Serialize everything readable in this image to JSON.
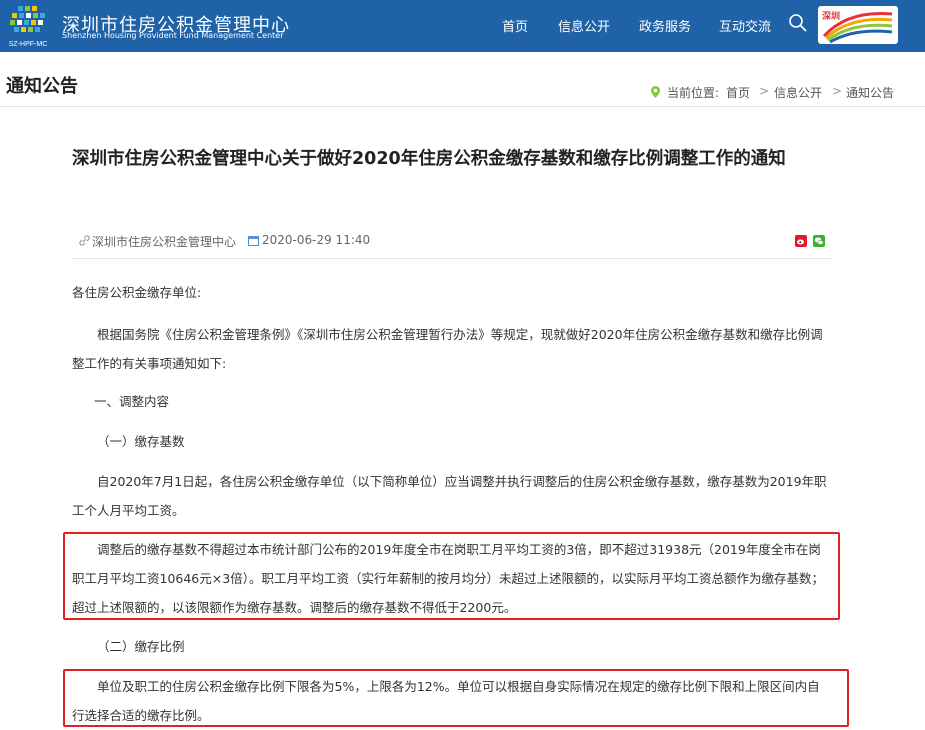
{
  "header": {
    "site_name_cn": "深圳市住房公积金管理中心",
    "site_name_en": "Shenzhen Housing Provident Fund Management Center",
    "logo_caption": "SZ-HPF-MC",
    "nav": [
      {
        "label": "首页"
      },
      {
        "label": "信息公开"
      },
      {
        "label": "政务服务"
      },
      {
        "label": "互动交流"
      }
    ],
    "brand_badge": "深圳"
  },
  "page": {
    "title": "通知公告",
    "breadcrumb": {
      "label": "当前位置:",
      "items": [
        "首页",
        "信息公开",
        "通知公告"
      ],
      "separator": ">"
    }
  },
  "article": {
    "title": "深圳市住房公积金管理中心关于做好2020年住房公积金缴存基数和缴存比例调整工作的通知",
    "source": "深圳市住房公积金管理中心",
    "date": "2020-06-29 11:40",
    "paragraphs": [
      "各住房公积金缴存单位:",
      "根据国务院《住房公积金管理条例》《深圳市住房公积金管理暂行办法》等规定，现就做好2020年住房公积金缴存基数和缴存比例调整工作的有关事项通知如下:",
      "一、调整内容",
      "（一）缴存基数",
      "自2020年7月1日起，各住房公积金缴存单位（以下简称单位）应当调整并执行调整后的住房公积金缴存基数，缴存基数为2019年职工个人月平均工资。",
      "调整后的缴存基数不得超过本市统计部门公布的2019年度全市在岗职工月平均工资的3倍，即不超过31938元（2019年度全市在岗职工月平均工资10646元×3倍）。职工月平均工资（实行年薪制的按月均分）未超过上述限额的，以实际月平均工资总额作为缴存基数；超过上述限额的，以该限额作为缴存基数。调整后的缴存基数不得低于2200元。",
      "（二）缴存比例",
      "单位及职工的住房公积金缴存比例下限各为5%，上限各为12%。单位可以根据自身实际情况在规定的缴存比例下限和上限区间内自行选择合适的缴存比例。"
    ]
  },
  "colors": {
    "header_bg": "#1f62a8",
    "highlight": "#e52020",
    "text": "#333333"
  }
}
